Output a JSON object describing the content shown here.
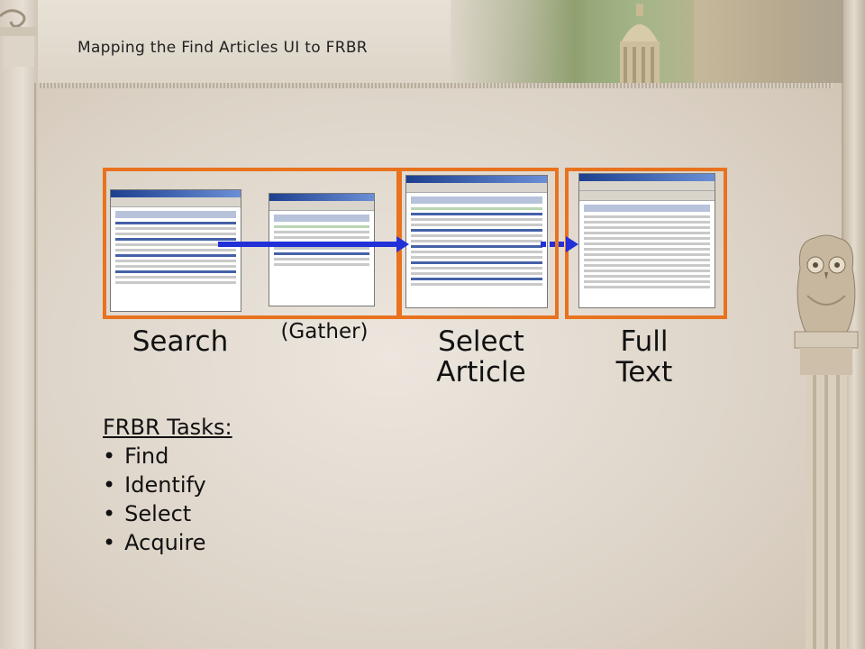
{
  "header": {
    "title": "Mapping the Find Articles UI to FRBR"
  },
  "steps": {
    "search": "Search",
    "gather": "(Gather)",
    "select_line1": "Select",
    "select_line2": "Article",
    "full_line1": "Full",
    "full_line2": "Text"
  },
  "tasks": {
    "heading": "FRBR Tasks:",
    "items": [
      "Find",
      "Identify",
      "Select",
      "Acquire"
    ]
  },
  "colors": {
    "frame": "#e8721e",
    "arrow": "#2230d8"
  }
}
